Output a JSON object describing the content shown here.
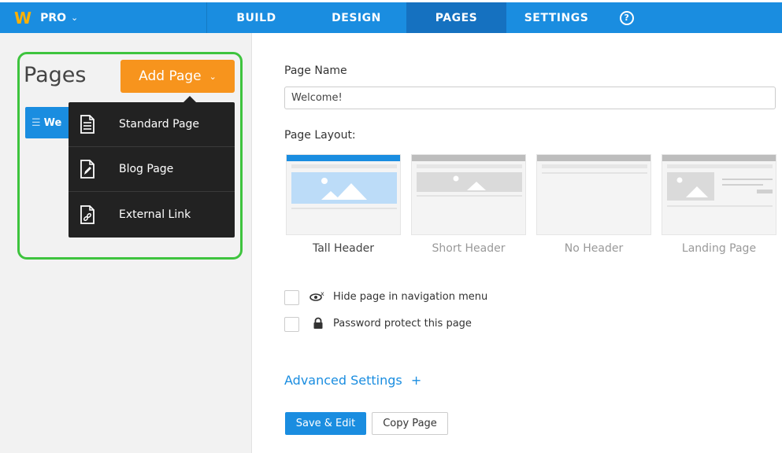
{
  "topbar": {
    "logo": "W",
    "plan": "PRO",
    "nav": [
      {
        "label": "BUILD"
      },
      {
        "label": "DESIGN"
      },
      {
        "label": "PAGES"
      },
      {
        "label": "SETTINGS"
      }
    ],
    "help": "?",
    "active_tab": "PAGES",
    "colors": {
      "bar": "#1a8de0",
      "active": "#1571c0",
      "logo": "#ffb000"
    }
  },
  "sidebar": {
    "title": "Pages",
    "add_page_label": "Add Page",
    "current_page_tab": "We",
    "dropdown": [
      {
        "label": "Standard Page",
        "icon": "document-icon"
      },
      {
        "label": "Blog Page",
        "icon": "blog-edit-icon"
      },
      {
        "label": "External Link",
        "icon": "link-icon"
      }
    ],
    "colors": {
      "add_button": "#f7941d",
      "highlight": "#3ec43e"
    }
  },
  "form": {
    "page_name_label": "Page Name",
    "page_name_value": "Welcome!",
    "page_layout_label": "Page Layout:",
    "layouts": [
      {
        "name": "Tall Header",
        "selected": true
      },
      {
        "name": "Short Header",
        "selected": false
      },
      {
        "name": "No Header",
        "selected": false
      },
      {
        "name": "Landing Page",
        "selected": false
      }
    ],
    "options": [
      {
        "label": "Hide page in navigation menu",
        "icon": "hidden-eye-icon",
        "checked": false
      },
      {
        "label": "Password protect this page",
        "icon": "lock-icon",
        "checked": false
      }
    ],
    "advanced_settings": "Advanced Settings",
    "advanced_plus": "+",
    "save_label": "Save & Edit",
    "copy_label": "Copy Page"
  }
}
